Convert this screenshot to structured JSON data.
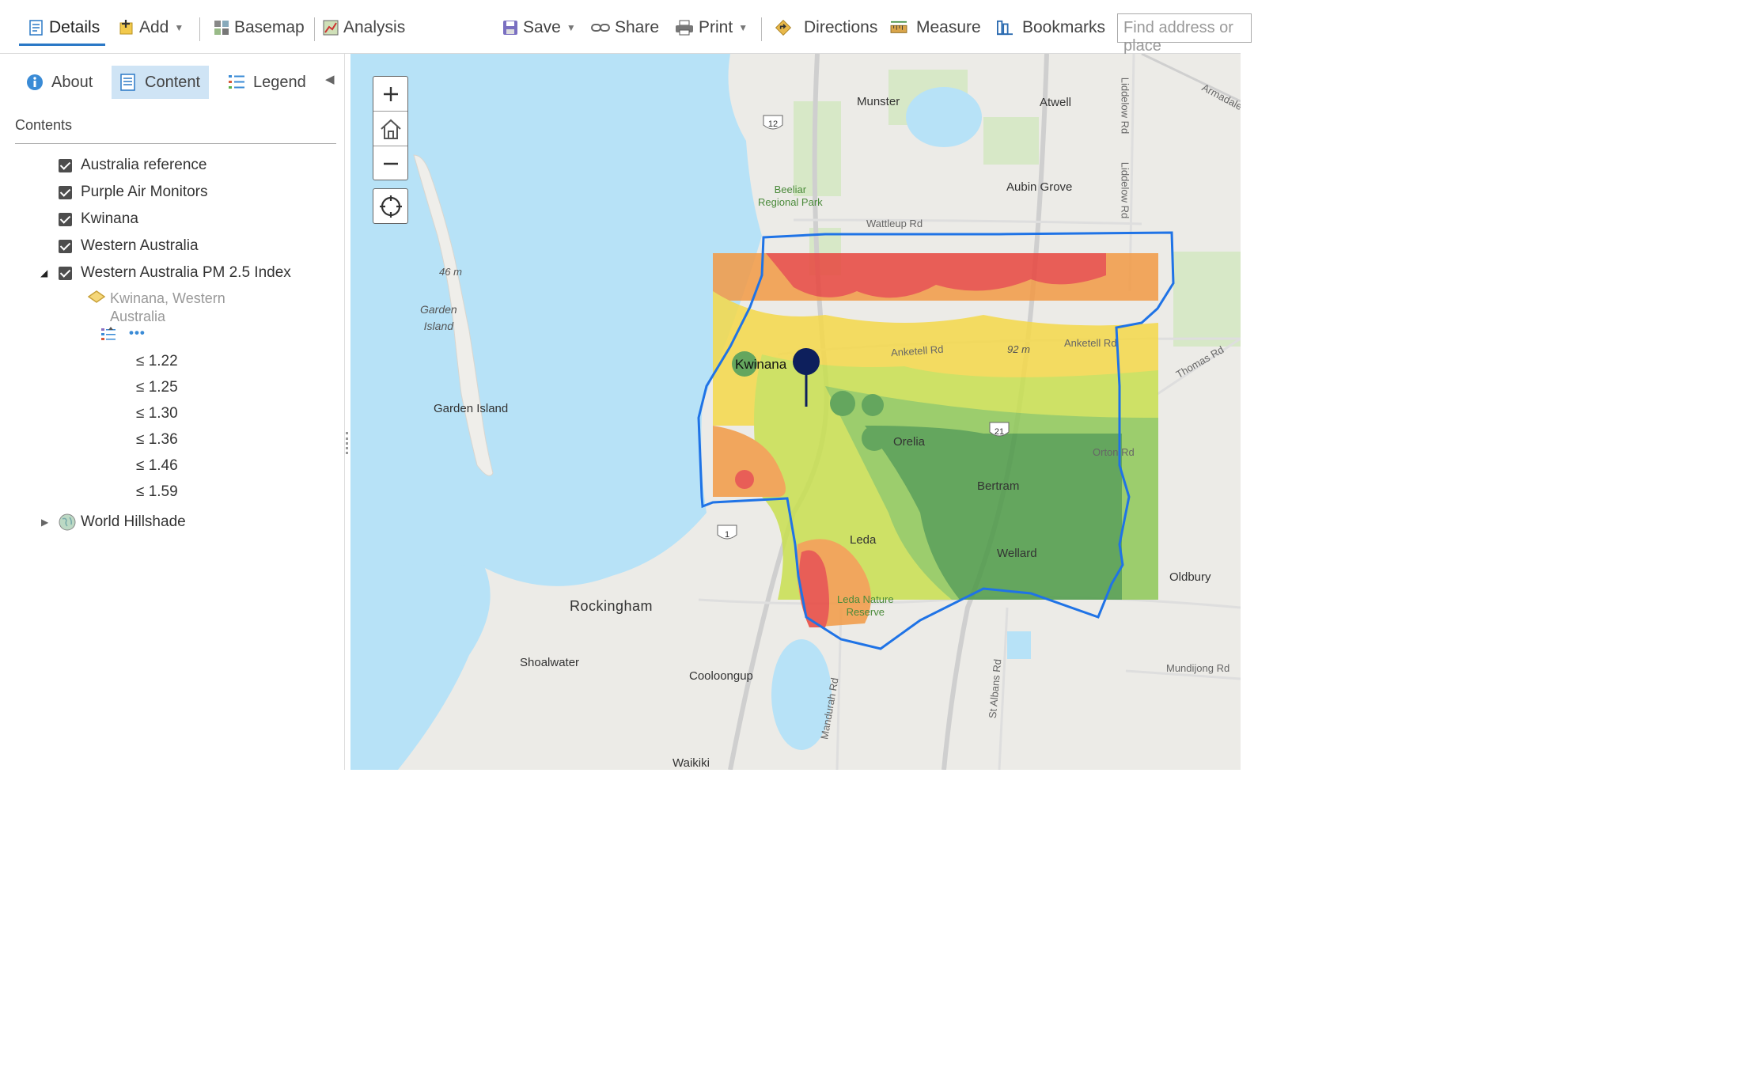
{
  "toolbar": {
    "details": "Details",
    "add": "Add",
    "basemap": "Basemap",
    "analysis": "Analysis",
    "save": "Save",
    "share": "Share",
    "print": "Print",
    "directions": "Directions",
    "measure": "Measure",
    "bookmarks": "Bookmarks",
    "search_placeholder": "Find address or place"
  },
  "panel": {
    "tabs": {
      "about": "About",
      "content": "Content",
      "legend": "Legend"
    },
    "heading": "Contents",
    "layers": [
      {
        "label": "Australia reference",
        "checked": true
      },
      {
        "label": "Purple Air Monitors",
        "checked": true
      },
      {
        "label": "Kwinana",
        "checked": true
      },
      {
        "label": "Western Australia",
        "checked": true
      },
      {
        "label": "Western Australia PM 2.5 Index",
        "checked": true
      }
    ],
    "sublayer": "Kwinana, Western Australia",
    "legend_items": [
      "≤ 1.22",
      "≤ 1.25",
      "≤ 1.30",
      "≤ 1.36",
      "≤ 1.46",
      "≤ 1.59"
    ],
    "hillshade": "World Hillshade"
  },
  "map": {
    "places": {
      "munster": "Munster",
      "atwell": "Atwell",
      "aubin_grove": "Aubin Grove",
      "beeliar_1": "Beeliar",
      "beeliar_2": "Regional Park",
      "kwinana": "Kwinana",
      "orelia": "Orelia",
      "bertram": "Bertram",
      "leda": "Leda",
      "wellard": "Wellard",
      "oldbury": "Oldbury",
      "rockingham": "Rockingham",
      "shoalwater": "Shoalwater",
      "cooloongup": "Cooloongup",
      "waikiki": "Waikiki",
      "garden_island": "Garden Island",
      "garden_1": "Garden",
      "garden_2": "Island",
      "leda_reserve_1": "Leda Nature",
      "leda_reserve_2": "Reserve"
    },
    "roads": {
      "wattleup": "Wattleup Rd",
      "anketell_1": "Anketell Rd",
      "anketell_2": "Anketell Rd",
      "thomas": "Thomas Rd",
      "orton": "Orton Rd",
      "liddelow_1": "Liddelow Rd",
      "liddelow_2": "Liddelow Rd",
      "armadale": "Armadale",
      "mundijong": "Mundijong Rd",
      "mandurah": "Mandurah Rd",
      "st_albans": "St Albans Rd"
    },
    "elevations": {
      "e46": "46 m",
      "e92": "92 m"
    },
    "shields": {
      "r12": "12",
      "r21": "21",
      "r1": "1"
    },
    "pm_colors": [
      "#e8463f",
      "#f39a45",
      "#f5d94a",
      "#c9e050",
      "#8fc858",
      "#4d9a47"
    ]
  }
}
